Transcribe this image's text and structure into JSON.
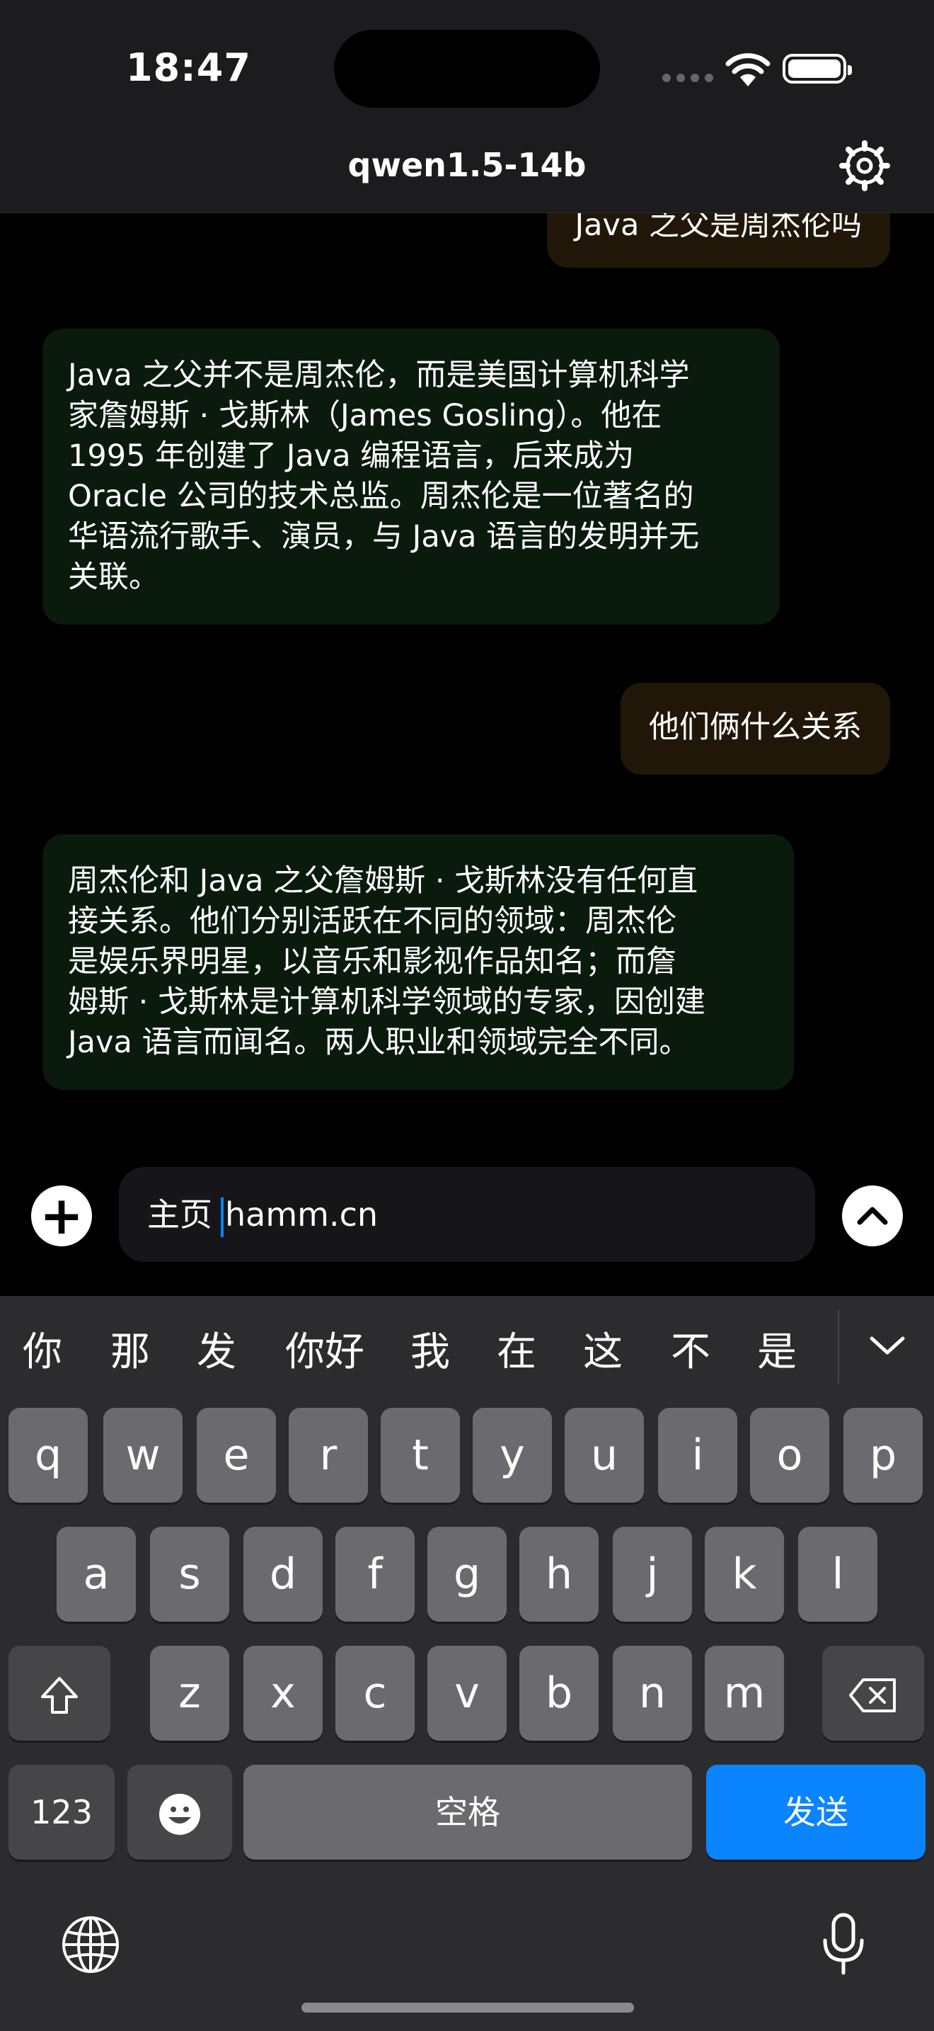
{
  "status_bar": {
    "time": "18:47"
  },
  "nav": {
    "title": "qwen1.5-14b",
    "settings_icon": "gear-icon"
  },
  "messages": [
    {
      "role": "user",
      "text": "Java 之父是周杰伦吗"
    },
    {
      "role": "assistant",
      "lines": [
        "Java 之父并不是周杰伦，而是美国计算机科学",
        "家詹姆斯 · 戈斯林（James Gosling）。他在",
        "1995 年创建了 Java 编程语言，后来成为",
        "Oracle 公司的技术总监。周杰伦是一位著名的",
        "华语流行歌手、演员，与 Java 语言的发明并无",
        "关联。"
      ]
    },
    {
      "role": "user",
      "text": "他们俩什么关系"
    },
    {
      "role": "assistant",
      "lines": [
        "周杰伦和 Java 之父詹姆斯 · 戈斯林没有任何直",
        "接关系。他们分别活跃在不同的领域：周杰伦",
        "是娱乐界明星，以音乐和影视作品知名；而詹",
        "姆斯 · 戈斯林是计算机科学领域的专家，因创建",
        "Java 语言而闻名。两人职业和领域完全不同。"
      ]
    }
  ],
  "composer": {
    "text_before": "主页",
    "text_after": "hamm.cn"
  },
  "keyboard": {
    "candidates": [
      "你",
      "那",
      "发",
      "你好",
      "我",
      "在",
      "这",
      "不",
      "是"
    ],
    "row1": [
      "q",
      "w",
      "e",
      "r",
      "t",
      "y",
      "u",
      "i",
      "o",
      "p"
    ],
    "row2": [
      "a",
      "s",
      "d",
      "f",
      "g",
      "h",
      "j",
      "k",
      "l"
    ],
    "row3": [
      "z",
      "x",
      "c",
      "v",
      "b",
      "n",
      "m"
    ],
    "numbers_label": "123",
    "space_label": "空格",
    "send_label": "发送"
  }
}
